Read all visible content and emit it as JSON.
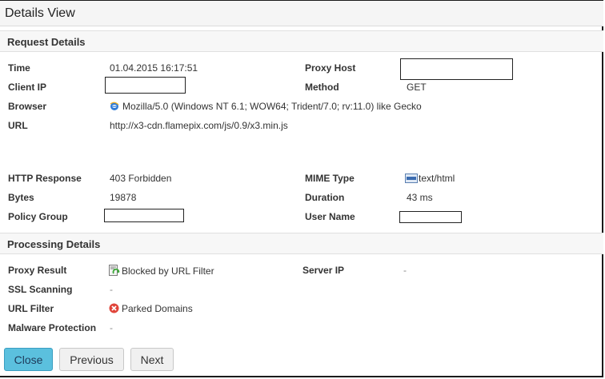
{
  "window": {
    "title": "Details View"
  },
  "request": {
    "header": "Request Details",
    "time_label": "Time",
    "time_value": "01.04.2015 16:17:51",
    "proxy_host_label": "Proxy Host",
    "client_ip_label": "Client IP",
    "method_label": "Method",
    "method_value": "GET",
    "browser_label": "Browser",
    "browser_value": "Mozilla/5.0 (Windows NT 6.1; WOW64; Trident/7.0; rv:11.0) like Gecko",
    "url_label": "URL",
    "url_value": "http://x3-cdn.flamepix.com/js/0.9/x3.min.js",
    "http_response_label": "HTTP Response",
    "http_response_value": "403 Forbidden",
    "mime_type_label": "MIME Type",
    "mime_type_value": "text/html",
    "bytes_label": "Bytes",
    "bytes_value": "19878",
    "duration_label": "Duration",
    "duration_value": "43 ms",
    "policy_group_label": "Policy Group",
    "user_name_label": "User Name"
  },
  "processing": {
    "header": "Processing Details",
    "proxy_result_label": "Proxy Result",
    "proxy_result_value": "Blocked by URL Filter",
    "server_ip_label": "Server IP",
    "server_ip_value": "-",
    "ssl_label": "SSL Scanning",
    "ssl_value": "-",
    "url_filter_label": "URL Filter",
    "url_filter_value": "Parked Domains",
    "malware_label": "Malware Protection",
    "malware_value": "-"
  },
  "buttons": {
    "close": "Close",
    "previous": "Previous",
    "next": "Next"
  },
  "icons": {
    "browser": "ie-browser-icon",
    "mime": "html-file-icon",
    "proxy_result": "blocked-filter-icon",
    "url_filter": "blocked-x-icon"
  },
  "colors": {
    "primary_button": "#5bc0de",
    "blocked_red": "#e0443a"
  }
}
